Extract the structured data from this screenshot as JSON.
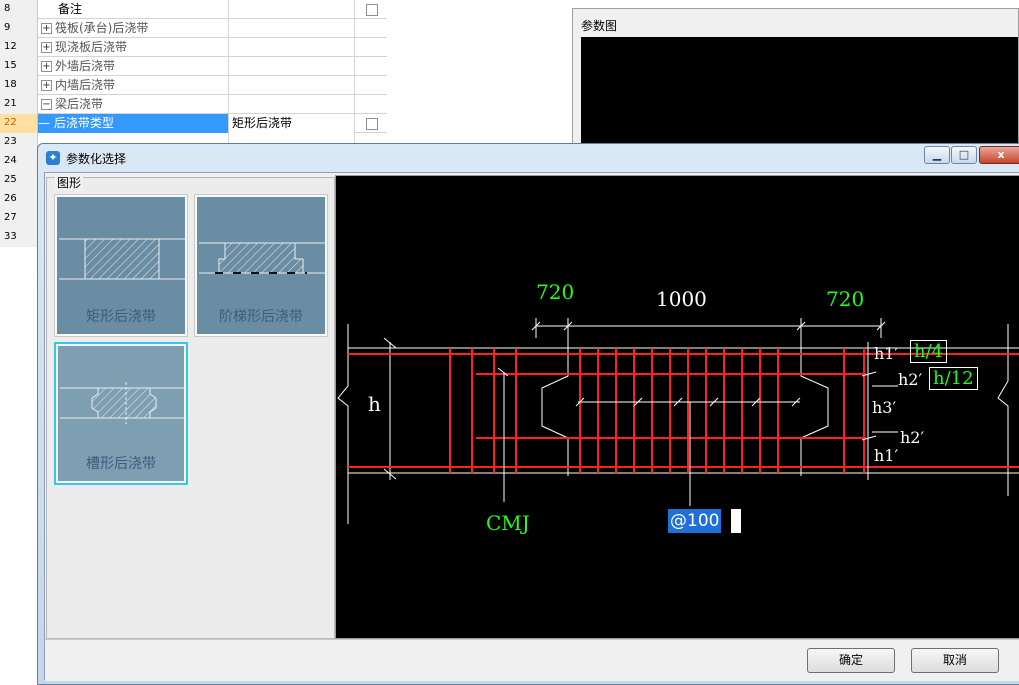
{
  "grid": {
    "rows": [
      {
        "num": "8",
        "name": "备注",
        "expander": "",
        "value": "",
        "checkbox": true
      },
      {
        "num": "9",
        "name": "筏板(承台)后浇带",
        "expander": "+",
        "value": "",
        "checkbox": false
      },
      {
        "num": "12",
        "name": "现浇板后浇带",
        "expander": "+",
        "value": "",
        "checkbox": false
      },
      {
        "num": "15",
        "name": "外墙后浇带",
        "expander": "+",
        "value": "",
        "checkbox": false
      },
      {
        "num": "18",
        "name": "内墙后浇带",
        "expander": "+",
        "value": "",
        "checkbox": false
      },
      {
        "num": "21",
        "name": "梁后浇带",
        "expander": "−",
        "value": "",
        "checkbox": false
      },
      {
        "num": "22",
        "name": "后浇带类型",
        "expander": "",
        "value": "矩形后浇带",
        "checkbox": true
      },
      {
        "num": "23",
        "name": "",
        "expander": "",
        "value": "",
        "checkbox": false
      },
      {
        "num": "24",
        "name": "",
        "expander": "",
        "value": "",
        "checkbox": false
      },
      {
        "num": "25",
        "name": "",
        "expander": "",
        "value": "",
        "checkbox": false
      },
      {
        "num": "26",
        "name": "",
        "expander": "",
        "value": "",
        "checkbox": false
      },
      {
        "num": "27",
        "name": "",
        "expander": "",
        "value": "",
        "checkbox": false
      },
      {
        "num": "33",
        "name": "",
        "expander": "",
        "value": "",
        "checkbox": false
      }
    ]
  },
  "param_panel": {
    "title": "参数图"
  },
  "dialog": {
    "title": "参数化选择",
    "minimize": "▁",
    "maximize": "□",
    "close": "x",
    "shape_group_label": "图形",
    "shapes": [
      {
        "label": "矩形后浇带",
        "selected": false
      },
      {
        "label": "阶梯形后浇带",
        "selected": false
      },
      {
        "label": "槽形后浇带",
        "selected": true
      }
    ],
    "cad": {
      "dim_left": "720",
      "dim_mid": "1000",
      "dim_right": "720",
      "h_label": "h",
      "h1_top": "h1′",
      "h1_top_value": "h/4",
      "h2_top": "h2′",
      "h2_top_value": "h/12",
      "h3": "h3′",
      "h2_bottom": "h2′",
      "h1_bottom": "h1′",
      "cmj": "CMJ",
      "spacing_input": "@100"
    },
    "ok_label": "确定",
    "cancel_label": "取消"
  }
}
